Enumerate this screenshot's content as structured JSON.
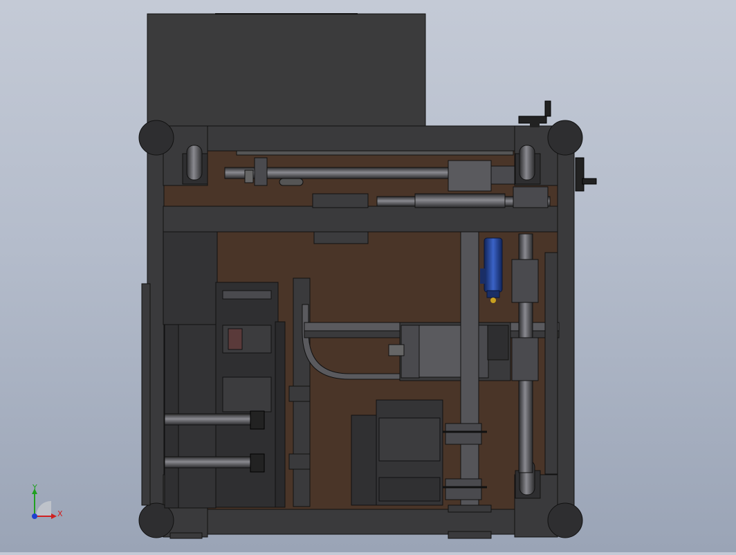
{
  "viewport": {
    "background_top": "#c4cad6",
    "background_bottom": "#9aa4b6"
  },
  "model": {
    "panel_color": "#4a3528",
    "frame_color": "#3a3a3c",
    "tube_color": "#6a6a6e",
    "motor_color": "#1f3d8a"
  },
  "triad": {
    "x_label": "X",
    "y_label": "Y",
    "x_color": "#d02020",
    "y_color": "#20a020",
    "z_color": "#2040d0"
  }
}
